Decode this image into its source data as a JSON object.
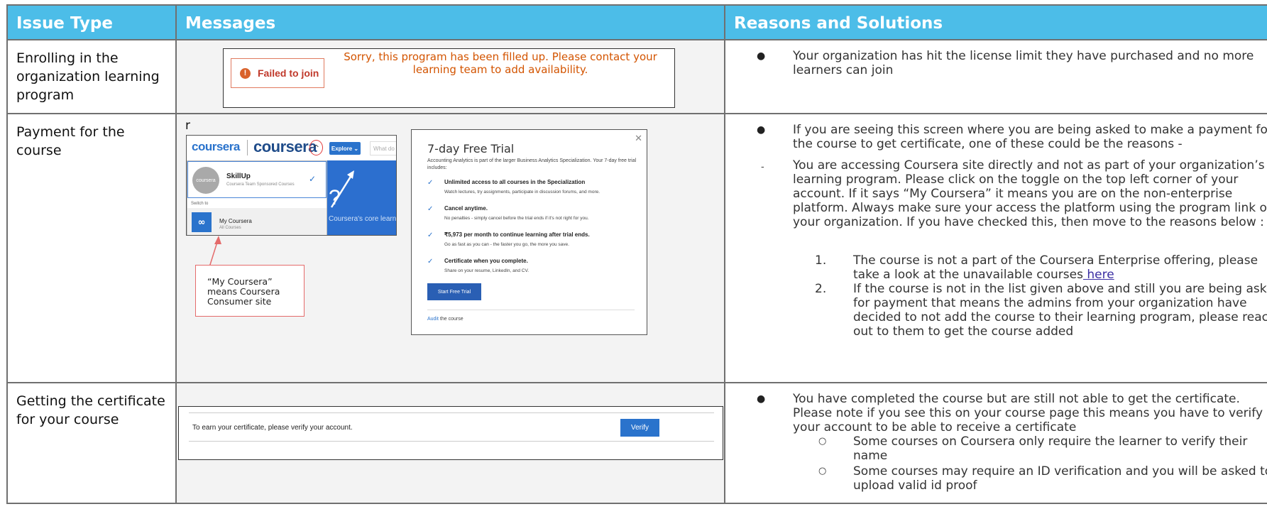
{
  "headers": {
    "issue_type": "Issue Type",
    "messages": "Messages",
    "reasons": "Reasons and Solutions"
  },
  "rows": [
    {
      "issue": "Enrolling in the organization learning program",
      "message": {
        "button_label": "Failed to join",
        "icon": "exclamation-icon",
        "text": "Sorry, this program has been filled up. Please contact your learning team to add availability."
      },
      "reasons": {
        "bullet": "Your organization has hit the license limit they have purchased and no more learners can join"
      }
    },
    {
      "issue": "Payment for the course",
      "stray_char": "r",
      "screenshot": {
        "logo_small": "coursera",
        "logo_large": "coursera",
        "toggle_icon": "chevron-up-icon",
        "explore_label": "Explore ⌄",
        "search_placeholder": "What do",
        "selected_account": "SkillUp",
        "selected_sub": "Coursera Team Sponsored Courses",
        "avatar_text": "coursera",
        "switch_to": "Switch to",
        "other_account": "My Coursera",
        "other_sub": "All Courses",
        "hero_text": "Coursera's core learn"
      },
      "callout": "“My Coursera” means Coursera Consumer site",
      "trial": {
        "title": "7-day Free Trial",
        "intro": "Accounting Analytics is part of the larger Business Analytics Specialization. Your 7-day free trial includes:",
        "features": [
          {
            "title": "Unlimited access to all courses in the Specialization",
            "desc": "Watch lectures, try assignments, participate in discussion forums, and more."
          },
          {
            "title": "Cancel anytime.",
            "desc": "No penalties - simply cancel before the trial ends if it's not right for you."
          },
          {
            "title": "₹5,973 per month to continue learning after trial ends.",
            "desc": "Go as fast as you can - the faster you go, the more you save."
          },
          {
            "title": "Certificate when you complete.",
            "desc": "Share on your resume, LinkedIn, and CV."
          }
        ],
        "start_label": "Start Free Trial",
        "audit_link": "Audit",
        "audit_rest": " the course",
        "close_icon": "close-icon"
      },
      "reasons": {
        "bullet": "If you are seeing this screen where you are being asked to make a payment for the course to get certificate, one of these could be the reasons -",
        "dash_marker": "-",
        "dash_text": "You are accessing Coursera site directly and not as part of your organization’s learning program. Please click on the toggle on the top left corner of your account. If it says “My Coursera” it means you are on the non-enterprise platform. Always make sure your access the platform using the program link of your organization. If you have checked this, then move to the reasons below :",
        "numbered": [
          {
            "num": "1.",
            "text": "The course is not a part of the Coursera Enterprise offering, please take a look at the unavailable courses",
            "link": " here"
          },
          {
            "num": "2.",
            "text": "If the course is not in the list given above and still you are being asked for payment that means the admins from your organization have decided to not add the course to their learning program, please reach out to them to get the course added"
          }
        ]
      }
    },
    {
      "issue": "Getting the certificate for your course",
      "message": {
        "text": "To earn your certificate, please verify your account.",
        "button_label": "Verify"
      },
      "reasons": {
        "bullet": "You have completed the course but are still not able to get the certificate. Please note if you see this on your course page this means you have to verify your account to be able to receive a certificate",
        "subs": [
          "Some courses on Coursera only require the learner to verify their name",
          "Some courses may require an ID verification and you will be asked to upload valid id proof"
        ]
      }
    }
  ],
  "markers": {
    "bullet": "●",
    "circle": "○"
  },
  "colors": {
    "header_bg": "#4cbde8",
    "accent_blue": "#2a73cc",
    "error_orange": "#d35400",
    "callout_red": "#e46b6b"
  }
}
